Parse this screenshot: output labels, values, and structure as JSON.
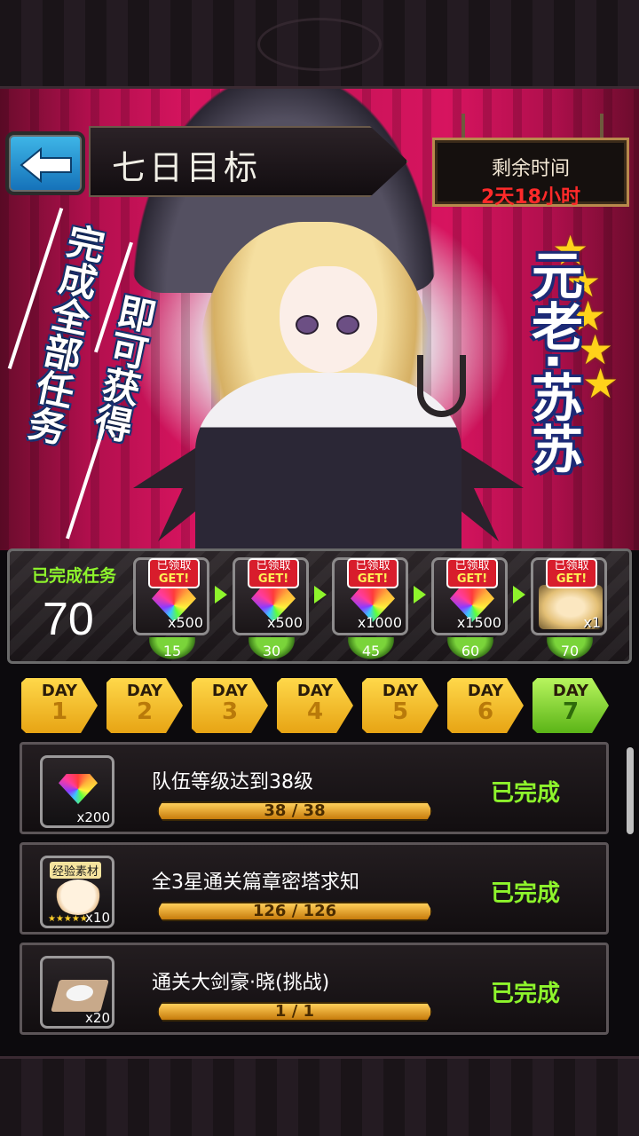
{
  "header": {
    "title": "七日目标",
    "timer_label": "剩余时间",
    "timer_value": "2天18小时"
  },
  "banner": {
    "promo_line1": "完成全部任务",
    "promo_line2": "即可获得",
    "character_name": "元老·苏苏",
    "star_count": 5
  },
  "progress": {
    "completed_label": "已完成任务",
    "completed_value": "70",
    "rewards": [
      {
        "claimed_label": "已领取",
        "get_label": "GET!",
        "icon": "rainbow-gem-icon",
        "quantity": "x500",
        "milestone": "15"
      },
      {
        "claimed_label": "已领取",
        "get_label": "GET!",
        "icon": "rainbow-gem-icon",
        "quantity": "x500",
        "milestone": "30"
      },
      {
        "claimed_label": "已领取",
        "get_label": "GET!",
        "icon": "rainbow-gem-icon",
        "quantity": "x1000",
        "milestone": "45"
      },
      {
        "claimed_label": "已领取",
        "get_label": "GET!",
        "icon": "rainbow-gem-icon",
        "quantity": "x1500",
        "milestone": "60"
      },
      {
        "claimed_label": "已领取",
        "get_label": "GET!",
        "icon": "character-portrait-icon",
        "quantity": "x1",
        "milestone": "70"
      }
    ]
  },
  "days": [
    {
      "label": "DAY",
      "number": "1",
      "active": false
    },
    {
      "label": "DAY",
      "number": "2",
      "active": false
    },
    {
      "label": "DAY",
      "number": "3",
      "active": false
    },
    {
      "label": "DAY",
      "number": "4",
      "active": false
    },
    {
      "label": "DAY",
      "number": "5",
      "active": false
    },
    {
      "label": "DAY",
      "number": "6",
      "active": false
    },
    {
      "label": "DAY",
      "number": "7",
      "active": true
    }
  ],
  "tasks": [
    {
      "icon": "rainbow-gem-icon",
      "icon_qty": "x200",
      "description": "队伍等级达到38级",
      "progress_text": "38 / 38",
      "progress": 1.0,
      "status": "已完成"
    },
    {
      "icon": "exp-material-icon",
      "icon_label": "经验素材",
      "icon_qty": "x10",
      "description": "全3星通关篇章密塔求知",
      "progress_text": "126 / 126",
      "progress": 1.0,
      "status": "已完成"
    },
    {
      "icon": "salt-item-icon",
      "icon_qty": "x20",
      "description": "通关大剑豪·晓(挑战)",
      "progress_text": "1 / 1",
      "progress": 1.0,
      "status": "已完成"
    }
  ],
  "colors": {
    "accent_green": "#8ef52c",
    "timer_red": "#ff2a2a",
    "gold": "#e7a414",
    "banner_magenta": "#d7145f"
  }
}
